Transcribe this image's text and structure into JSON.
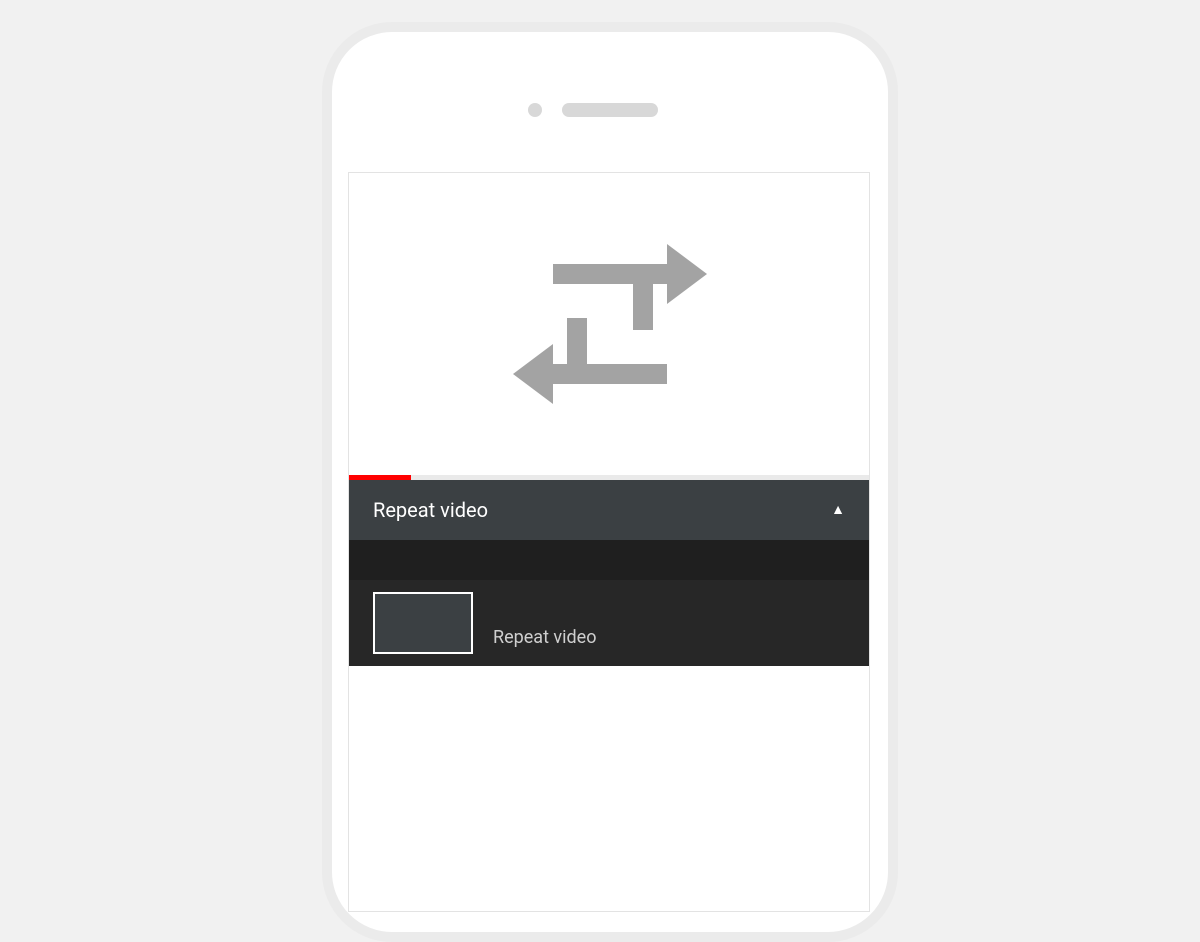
{
  "video": {
    "progress_percent": 12
  },
  "title_row": {
    "label": "Repeat video"
  },
  "playlist": {
    "items": [
      {
        "label": "Repeat video"
      }
    ]
  },
  "colors": {
    "accent": "#ff0000",
    "panel": "#3b4043",
    "dark": "#272727"
  }
}
